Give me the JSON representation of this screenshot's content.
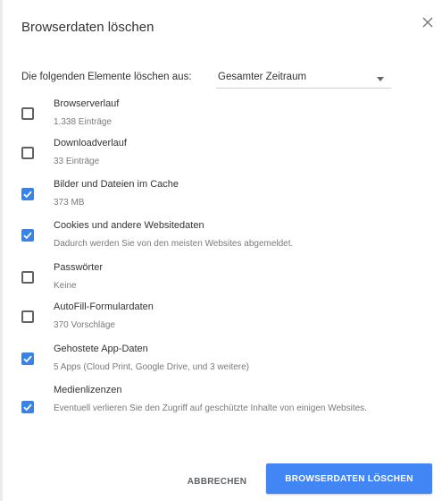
{
  "dialog": {
    "title": "Browserdaten löschen",
    "close_icon": "close-icon"
  },
  "time_range": {
    "label": "Die folgenden Elemente löschen aus:",
    "selected": "Gesamter Zeitraum"
  },
  "items": [
    {
      "label": "Browserverlauf",
      "detail": "1.338 Einträge",
      "checked": false
    },
    {
      "label": "Downloadverlauf",
      "detail": "33 Einträge",
      "checked": false
    },
    {
      "label": "Bilder und Dateien im Cache",
      "detail": "373 MB",
      "checked": true
    },
    {
      "label": "Cookies und andere Websitedaten",
      "detail": "Dadurch werden Sie von den meisten Websites abgemeldet.",
      "checked": true
    },
    {
      "label": "Passwörter",
      "detail": "Keine",
      "checked": false
    },
    {
      "label": "AutoFill-Formulardaten",
      "detail": "370 Vorschläge",
      "checked": false
    },
    {
      "label": "Gehostete App-Daten",
      "detail": "5 Apps (Cloud Print, Google Drive, und 3 weitere)",
      "checked": true
    },
    {
      "label": "Medienlizenzen",
      "detail": "Eventuell verlieren Sie den Zugriff auf geschützte Inhalte von einigen Websites.",
      "checked": true
    }
  ],
  "buttons": {
    "cancel": "ABBRECHEN",
    "confirm": "BROWSERDATEN LÖSCHEN"
  },
  "colors": {
    "accent": "#4286f5",
    "checkbox_checked": "#3b82e4"
  }
}
